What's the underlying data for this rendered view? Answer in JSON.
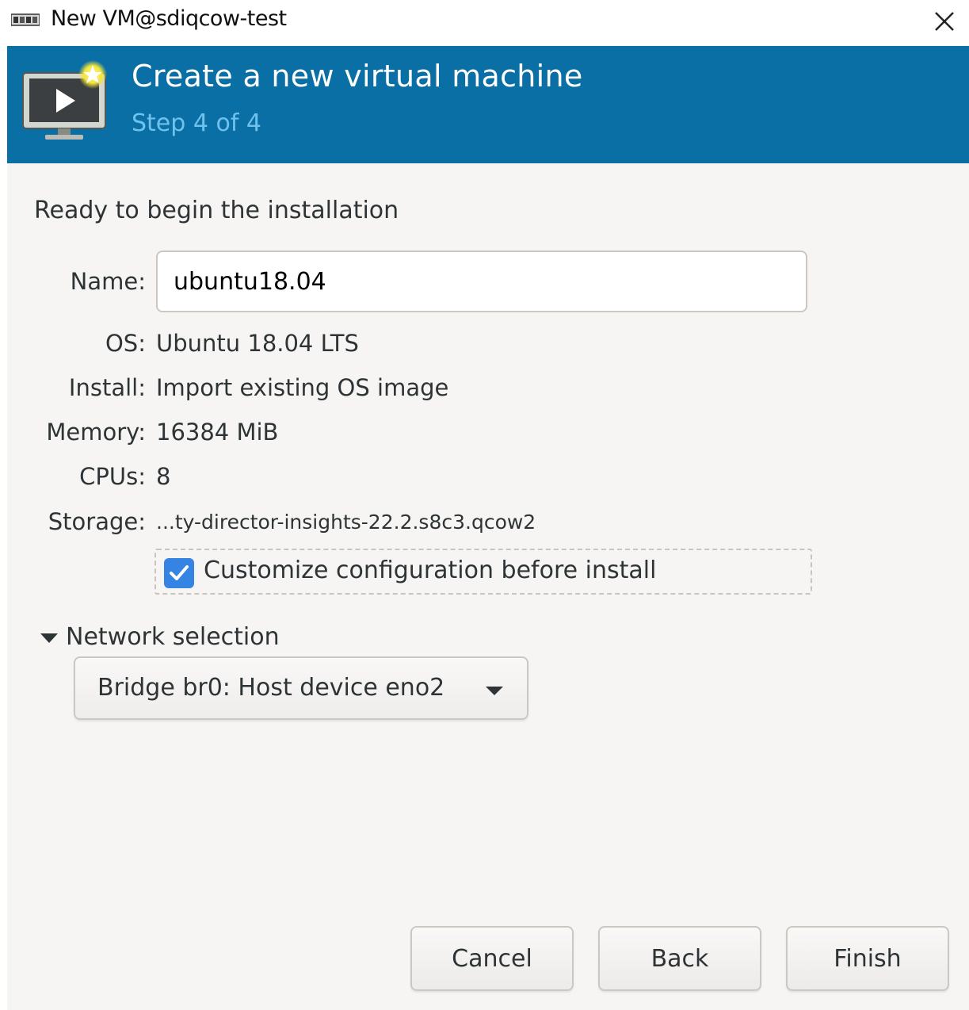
{
  "window": {
    "title": "New VM@sdiqcow-test",
    "icon": "vm-manager-icon",
    "close_icon": "close-icon"
  },
  "header": {
    "title": "Create a new virtual machine",
    "step": "Step 4 of 4",
    "icon": "new-vm-monitor-icon",
    "background_color": "#0a6fa5",
    "step_color": "#6fc2ec"
  },
  "summary": {
    "heading": "Ready to begin the installation",
    "name": {
      "label": "Name:",
      "value": "ubuntu18.04"
    },
    "os": {
      "label": "OS:",
      "value": "Ubuntu 18.04 LTS"
    },
    "install": {
      "label": "Install:",
      "value": "Import existing OS image"
    },
    "memory": {
      "label": "Memory:",
      "value": "16384 MiB"
    },
    "cpus": {
      "label": "CPUs:",
      "value": "8"
    },
    "storage": {
      "label": "Storage:",
      "value": "...ty-director-insights-22.2.s8c3.qcow2"
    },
    "customize": {
      "label": "Customize configuration before install",
      "checked": true,
      "check_color": "#3584e4"
    }
  },
  "network": {
    "expander_label": "Network selection",
    "expanded": true,
    "selected": "Bridge br0: Host device eno2"
  },
  "buttons": {
    "cancel": "Cancel",
    "back": "Back",
    "finish": "Finish"
  }
}
